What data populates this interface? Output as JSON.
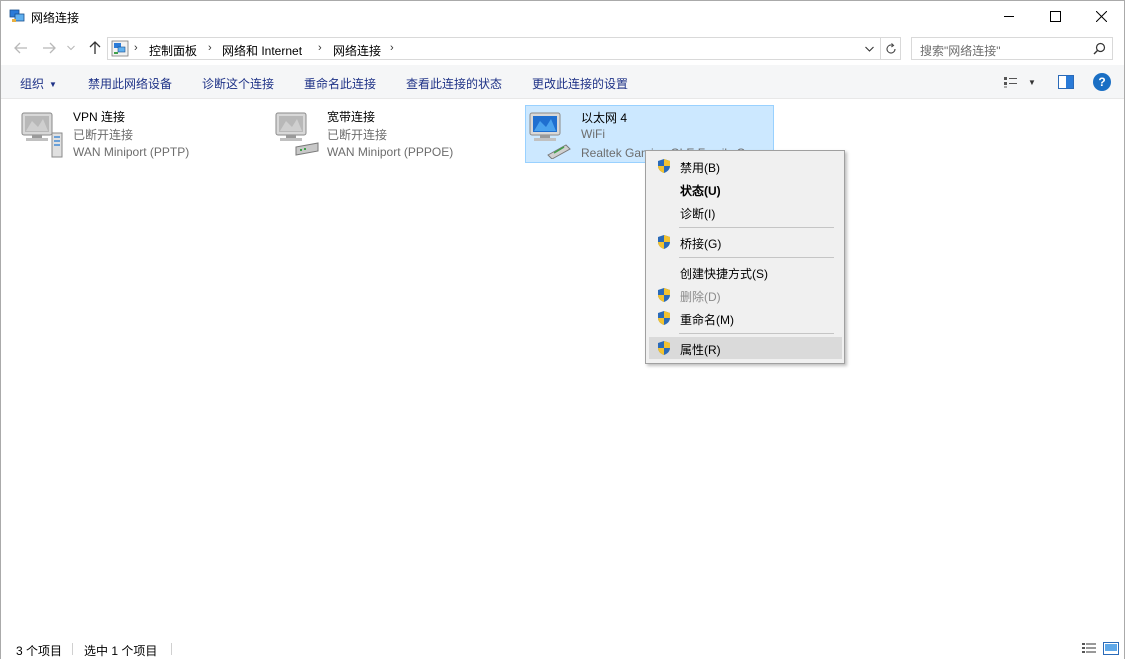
{
  "window": {
    "title": "网络连接"
  },
  "address": {
    "crumbs": [
      "控制面板",
      "网络和 Internet",
      "网络连接"
    ],
    "search_placeholder": "搜索\"网络连接\""
  },
  "toolbar": {
    "organize": "组织",
    "disable_device": "禁用此网络设备",
    "diagnose": "诊断这个连接",
    "rename": "重命名此连接",
    "view_status": "查看此连接的状态",
    "change_settings": "更改此连接的设置",
    "help": "?"
  },
  "connections": [
    {
      "name": "VPN 连接",
      "status": "已断开连接",
      "device": "WAN Miniport (PPTP)",
      "icon": "vpn-connection-icon",
      "selected": false
    },
    {
      "name": "宽带连接",
      "status": "已断开连接",
      "device": "WAN Miniport (PPPOE)",
      "icon": "broadband-connection-icon",
      "selected": false
    },
    {
      "name": "以太网 4",
      "status": "WiFi",
      "device": "Realtek Gaming GbE Family C...",
      "icon": "ethernet-connection-icon",
      "selected": true
    }
  ],
  "context_menu": {
    "items": [
      {
        "label": "禁用(B)",
        "shield": true,
        "bold": false,
        "disabled": false
      },
      {
        "label": "状态(U)",
        "shield": false,
        "bold": true,
        "disabled": false
      },
      {
        "label": "诊断(I)",
        "shield": false,
        "bold": false,
        "disabled": false
      },
      {
        "label": "桥接(G)",
        "shield": true,
        "bold": false,
        "disabled": false
      },
      {
        "label": "创建快捷方式(S)",
        "shield": false,
        "bold": false,
        "disabled": false
      },
      {
        "label": "删除(D)",
        "shield": true,
        "bold": false,
        "disabled": true
      },
      {
        "label": "重命名(M)",
        "shield": true,
        "bold": false,
        "disabled": false
      },
      {
        "label": "属性(R)",
        "shield": true,
        "bold": false,
        "disabled": false,
        "highlighted": true
      }
    ]
  },
  "statusbar": {
    "item_count": "3 个项目",
    "selected_count": "选中 1 个项目"
  },
  "colors": {
    "selection_bg": "#cce8ff",
    "selection_border": "#99d1ff",
    "command_text": "#1e3287",
    "help_blue": "#1a6fc4"
  }
}
